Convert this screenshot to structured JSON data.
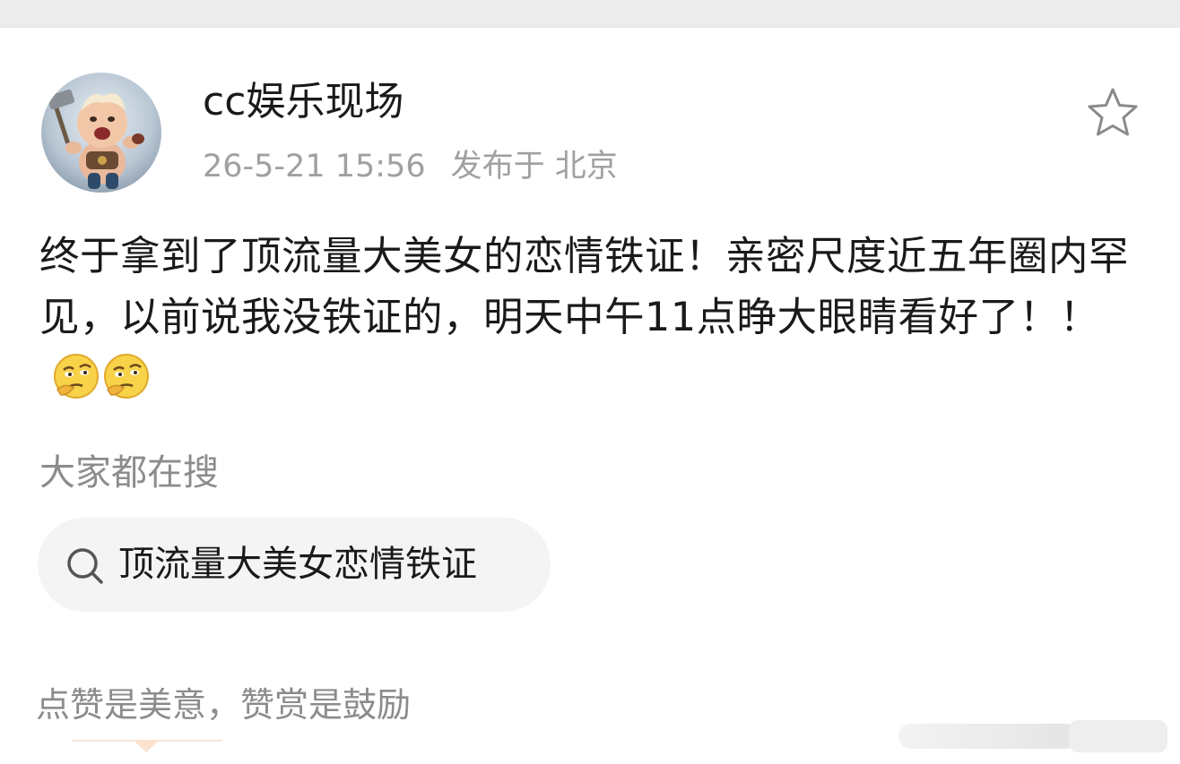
{
  "post": {
    "author": "cc娱乐现场",
    "time": "26-5-21 15:56",
    "location": "发布于 北京",
    "content": "终于拿到了顶流量大美女的恋情铁证！亲密尺度近五年圈内罕见，以前说我没铁证的，明天中午11点睁大眼睛看好了！！",
    "emojis": [
      "thinking-face-icon",
      "thinking-face-icon"
    ]
  },
  "search_section": {
    "label": "大家都在搜",
    "query": "顶流量大美女恋情铁证"
  },
  "reward": {
    "tip": "点赞是美意，赞赏是鼓励"
  },
  "icons": {
    "favorite": "star-outline-icon",
    "search": "search-icon"
  },
  "colors": {
    "text_primary": "#1a1a1a",
    "text_secondary": "#a0a0a0",
    "pill_background": "#f4f4f4"
  }
}
